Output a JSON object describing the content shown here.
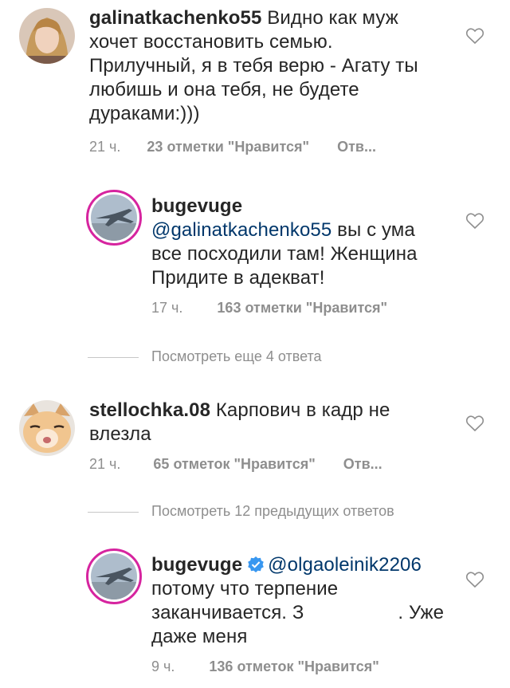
{
  "comments": [
    {
      "username": "galinatkachenko55",
      "text": "Видно как муж хочет восстановить семью. Прилучный, я в тебя верю - Агату ты любишь и она тебя, не будете дураками:)))",
      "time": "21 ч.",
      "likes": "23 отметки \"Нравится\"",
      "reply": "Отв..."
    },
    {
      "username": "bugevuge",
      "mention": "@galinatkachenko55",
      "text": "вы с ума все посходили там! Женщина Придите в адекват!",
      "time": "17 ч.",
      "likes": "163 отметки \"Нравится\""
    },
    {
      "username": "stellochka.08",
      "text": "Карпович в кадр не влезла",
      "time": "21 ч.",
      "likes": "65 отметок \"Нравится\"",
      "reply": "Отв..."
    },
    {
      "username": "bugevuge",
      "mention": "@olgaoleinik2206",
      "text_line1": "потому что терпение",
      "text_line2a": "заканчивается. З",
      "text_line2b": ". Уже",
      "text_line3": "даже меня",
      "time": "9 ч.",
      "likes": "136 отметок \"Нравится\""
    }
  ],
  "view_more_1": "Посмотреть еще 4 ответа",
  "view_more_2": "Посмотреть 12 предыдущих ответов",
  "icons": {
    "like": "heart-outline-icon",
    "verified": "verified-badge-icon"
  },
  "colors": {
    "mention": "#00376b",
    "meta": "#8e8e8e",
    "verified": "#3897f0",
    "story_ring": "#d6249f"
  }
}
